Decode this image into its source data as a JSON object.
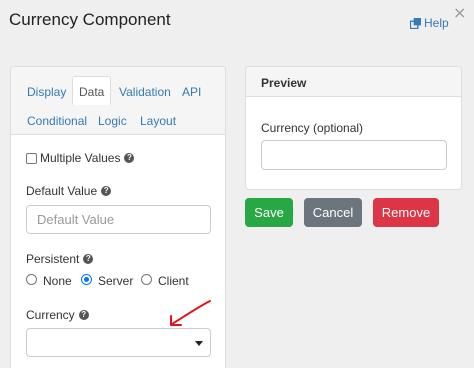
{
  "dialog": {
    "title": "Currency Component",
    "close_glyph": "×",
    "help_label": "Help",
    "help_icon": "external-link-icon"
  },
  "tabs": [
    {
      "label": "Display",
      "active": false
    },
    {
      "label": "Data",
      "active": true
    },
    {
      "label": "Validation",
      "active": false
    },
    {
      "label": "API",
      "active": false
    },
    {
      "label": "Conditional",
      "active": false
    },
    {
      "label": "Logic",
      "active": false
    },
    {
      "label": "Layout",
      "active": false
    }
  ],
  "form": {
    "multiple_values_label": "Multiple Values",
    "multiple_values_checked": false,
    "default_value_label": "Default Value",
    "default_value_placeholder": "Default Value",
    "persistent_label": "Persistent",
    "persistent_options": [
      {
        "label": "None",
        "checked": false
      },
      {
        "label": "Server",
        "checked": true
      },
      {
        "label": "Client",
        "checked": false
      }
    ],
    "currency_label": "Currency",
    "currency_value": "",
    "help_glyph": "?"
  },
  "preview": {
    "header": "Preview",
    "field_label": "Currency (optional)",
    "field_value": ""
  },
  "buttons": {
    "save_label": "Save",
    "cancel_label": "Cancel",
    "remove_label": "Remove"
  },
  "colors": {
    "save": "#28a745",
    "cancel": "#6c757d",
    "remove": "#dc3545",
    "link": "#337ab7",
    "annotation_arrow": "#e0141e"
  }
}
